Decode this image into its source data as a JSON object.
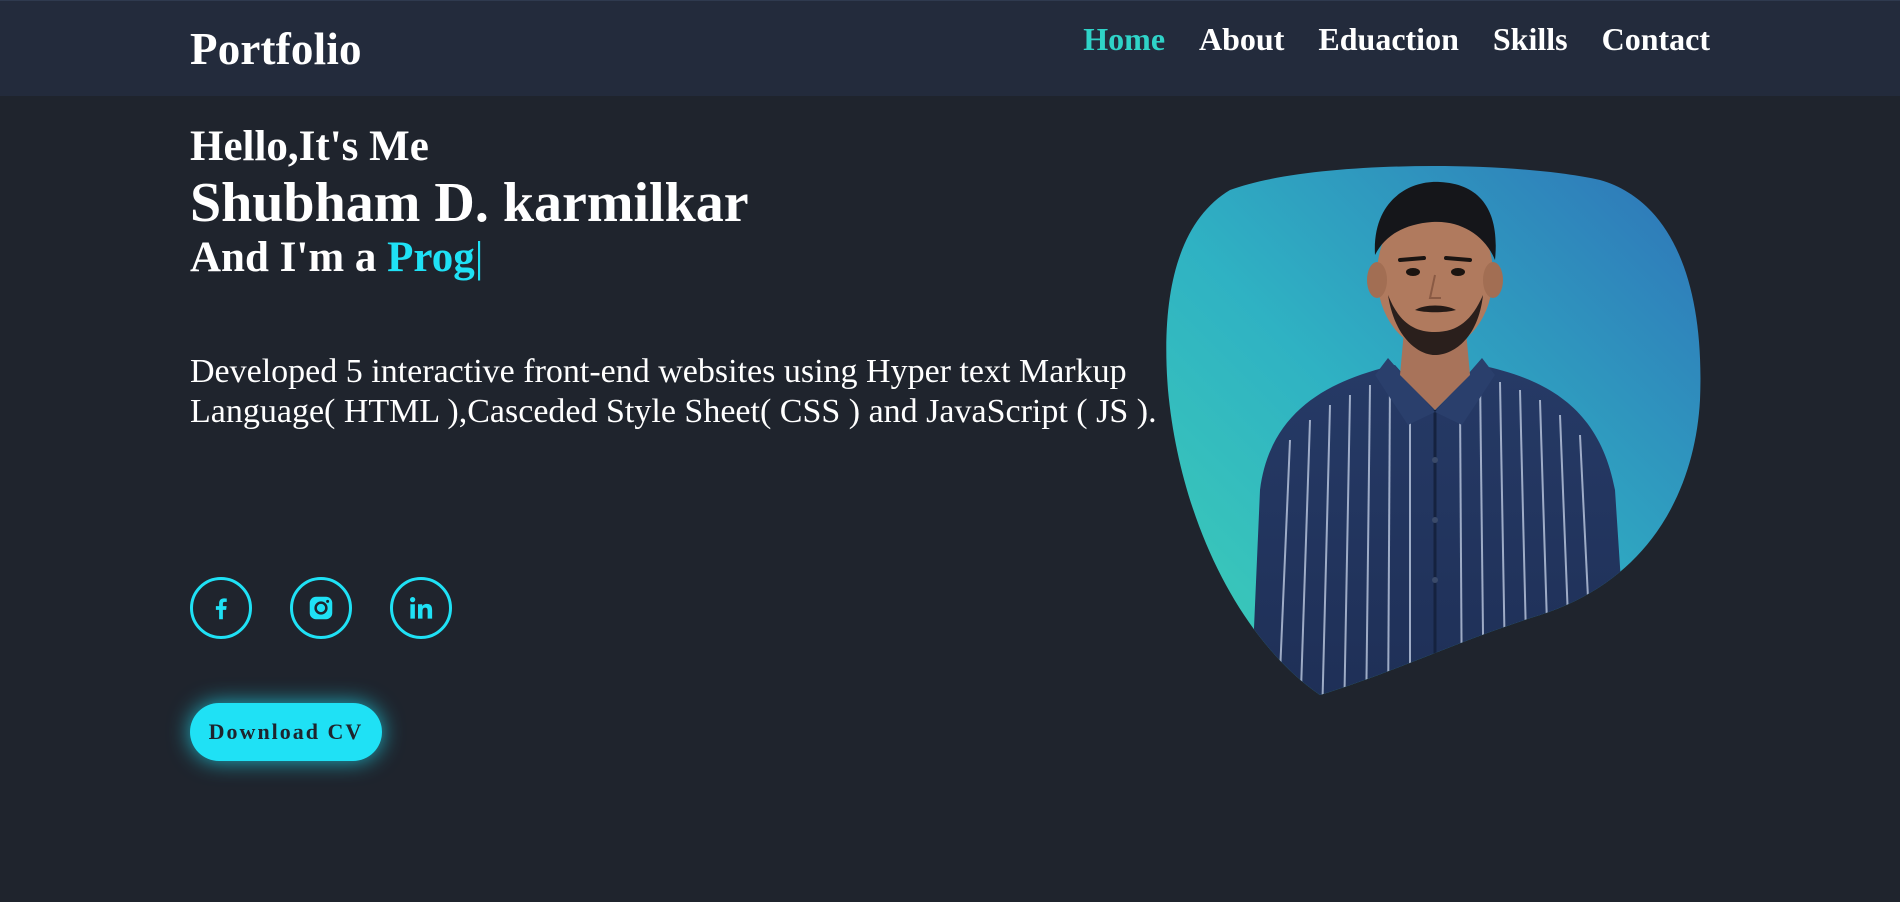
{
  "header": {
    "logo": "Portfolio",
    "nav": [
      {
        "label": "Home",
        "active": true
      },
      {
        "label": "About",
        "active": false
      },
      {
        "label": "Eduaction",
        "active": false
      },
      {
        "label": "Skills",
        "active": false
      },
      {
        "label": "Contact",
        "active": false
      }
    ]
  },
  "hero": {
    "greeting": "Hello,It's Me",
    "name": "Shubham D. karmilkar",
    "role_prefix": "And I'm a",
    "role_typed": "Prog",
    "cursor": "|",
    "description": "Developed 5 interactive front-end websites using Hyper text Markup Language( HTML ),Casceded Style Sheet( CSS ) and JavaScript ( JS )."
  },
  "socials": [
    {
      "icon": "facebook-icon"
    },
    {
      "icon": "instagram-icon"
    },
    {
      "icon": "linkedin-icon"
    }
  ],
  "cta": {
    "download_label": "Download CV"
  },
  "colors": {
    "background": "#1f242d",
    "navbar": "#232b3c",
    "accent": "#1fe1f5",
    "active_nav": "#2fd3c8"
  }
}
